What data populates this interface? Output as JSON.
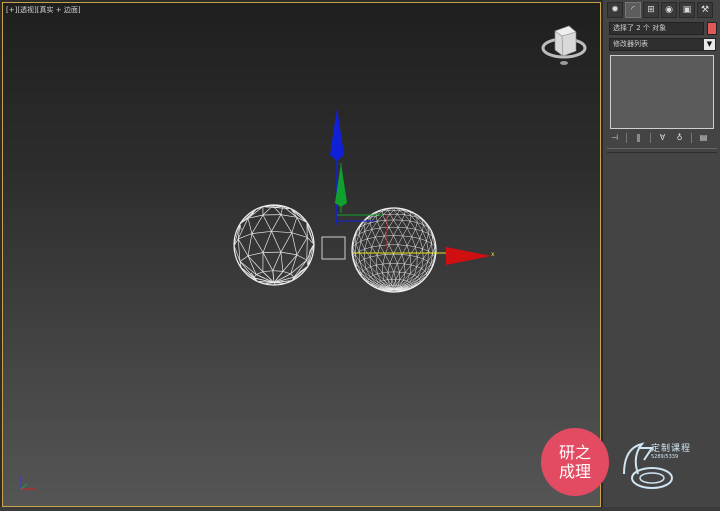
{
  "viewport": {
    "label_parts": [
      "[+]",
      "[透视]",
      "[真实 + 边面]"
    ],
    "gizmo_x_label": "x"
  },
  "command_panel": {
    "tab_icons": [
      "sun-icon",
      "curve-icon",
      "hierarchy-icon",
      "motion-icon",
      "display-icon",
      "hammer-icon"
    ],
    "selection_name": "选择了 2 个 对象",
    "object_color": "#e05a5a",
    "modifier_list": "修改器列表",
    "stack_tool_icons": [
      "pin-icon",
      "show-end-icon",
      "make-unique-icon",
      "remove-modifier-icon",
      "configure-icon"
    ]
  },
  "watermark": {
    "badge_line1": "研之",
    "badge_line2": "成理",
    "logo_text": "定制课程",
    "logo_sub": "5289/5339"
  },
  "colors": {
    "viewport_border": "#c9a24a",
    "gizmo_x": "#d01010",
    "gizmo_y": "#10a030",
    "gizmo_z": "#1020d8"
  }
}
